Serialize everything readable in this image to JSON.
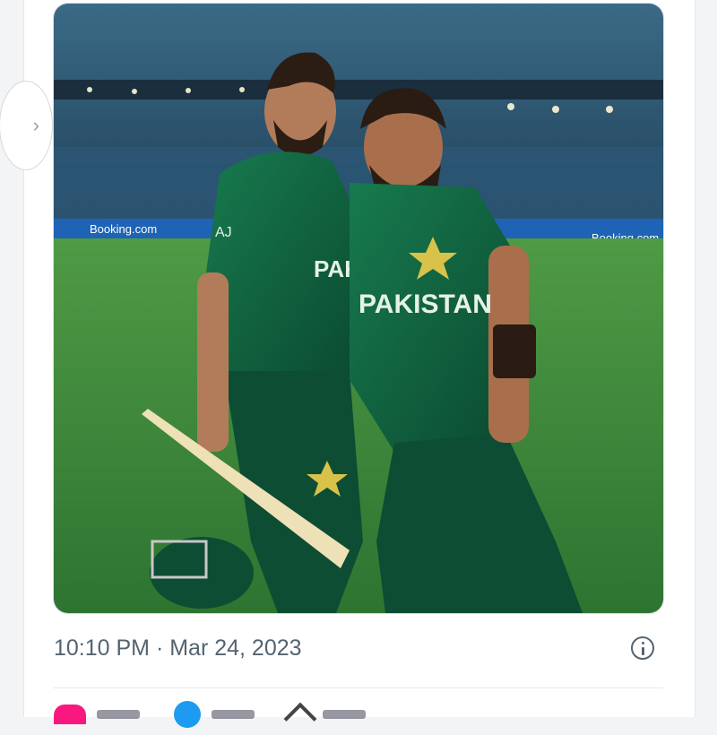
{
  "post": {
    "timestamp": "10:10 PM · Mar 24, 2023",
    "image": {
      "alt": "Two cricketers in green Pakistan jerseys posing on a cricket field",
      "jersey_text_left": "PAKIS",
      "jersey_text_right": "PAKISTAN",
      "jersey_initials": "AJ",
      "board_text": "Booking.com"
    }
  },
  "colors": {
    "jersey": "#0f5a3a",
    "pitch": "#3d8a3a",
    "stands": "#2a4f6a",
    "like": "#f91880",
    "reply": "#1d9bf0",
    "meta_text": "#536471"
  },
  "icons": {
    "nav": "chevron-right-icon",
    "info": "info-icon",
    "like": "heart-icon",
    "reply": "reply-icon",
    "share": "share-icon"
  }
}
